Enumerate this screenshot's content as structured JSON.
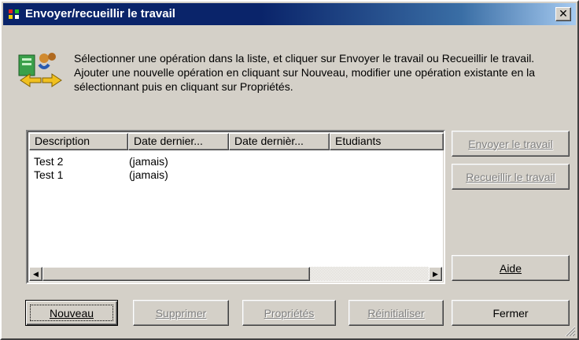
{
  "window": {
    "title": "Envoyer/recueillir le travail",
    "close_glyph": "✕"
  },
  "intro": {
    "icon": "send-collect-icon",
    "text": "Sélectionner une opération dans la liste, et cliquer sur Envoyer le travail ou Recueillir le travail. Ajouter une nouvelle opération en cliquant sur Nouveau, modifier une opération existante en la sélectionnant puis en cliquant sur Propriétés."
  },
  "list": {
    "columns": [
      "Description",
      "Date dernier...",
      "Date dernièr...",
      "Etudiants"
    ],
    "rows": [
      {
        "description": "Test 2",
        "date_sent": "(jamais)"
      },
      {
        "description": "Test 1",
        "date_sent": "(jamais)"
      }
    ]
  },
  "buttons": {
    "send": "Envoyer le travail",
    "collect": "Recueillir le travail",
    "help": "Aide",
    "new": "Nouveau",
    "delete": "Supprimer",
    "properties": "Propriétés",
    "reset": "Réinitialiser",
    "close": "Fermer"
  },
  "colors": {
    "title_start": "#0a246a",
    "title_end": "#a6caf0",
    "face": "#d4d0c8",
    "disabled_text": "#808080"
  }
}
